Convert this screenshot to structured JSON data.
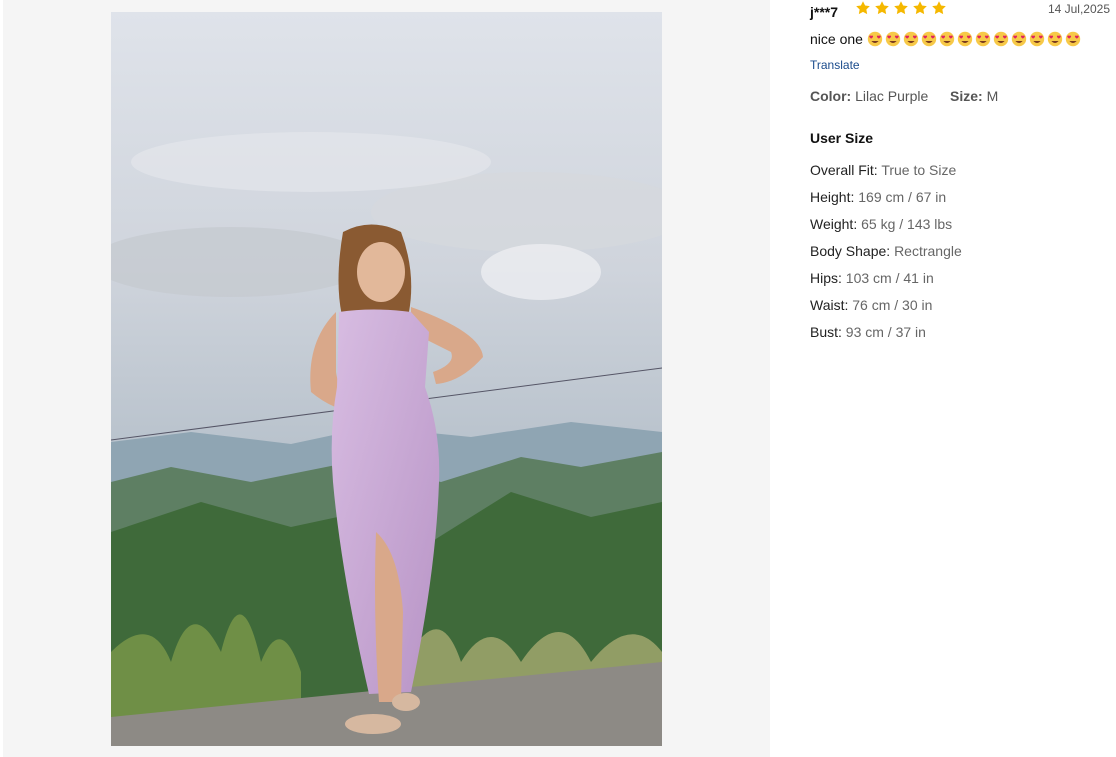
{
  "review": {
    "user": "j***7",
    "rating": 5,
    "date": "14 Jul,2025",
    "text": "nice one",
    "emoji": "heart-eyes-emoji",
    "emoji_count": 12,
    "translate_label": "Translate",
    "color_label": "Color:",
    "color_value": "Lilac Purple",
    "size_label": "Size:",
    "size_value": "M"
  },
  "user_size": {
    "title": "User Size",
    "rows": [
      {
        "label": "Overall Fit:",
        "value": "True to Size"
      },
      {
        "label": "Height:",
        "value": "169 cm / 67 in"
      },
      {
        "label": "Weight:",
        "value": "65 kg / 143 lbs"
      },
      {
        "label": "Body Shape:",
        "value": "Rectrangle"
      },
      {
        "label": "Hips:",
        "value": "103 cm / 41 in"
      },
      {
        "label": "Waist:",
        "value": "76 cm / 30 in"
      },
      {
        "label": "Bust:",
        "value": "93 cm / 37 in"
      }
    ]
  },
  "colors": {
    "star": "#f5b800",
    "link": "#1a4b8c",
    "panel_bg": "#f5f5f5",
    "dress": "#c9a8d4"
  }
}
